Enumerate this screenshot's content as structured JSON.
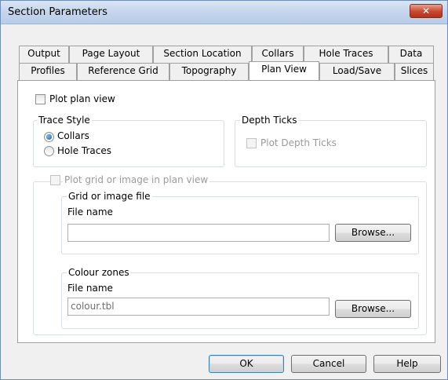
{
  "window": {
    "title": "Section Parameters",
    "close_glyph": "✕"
  },
  "tabs": {
    "row1": [
      "Output",
      "Page Layout",
      "Section Location",
      "Collars",
      "Hole Traces",
      "Data"
    ],
    "row2": [
      "Profiles",
      "Reference Grid",
      "Topography",
      "Plan View",
      "Load/Save",
      "Slices"
    ],
    "active": "Plan View"
  },
  "plan_view": {
    "plot_plan_view_label": "Plot plan view",
    "plot_plan_view_checked": false,
    "trace_style": {
      "title": "Trace Style",
      "options": [
        "Collars",
        "Hole Traces"
      ],
      "selected": "Collars"
    },
    "depth_ticks": {
      "title": "Depth Ticks",
      "plot_depth_ticks_label": "Plot Depth Ticks",
      "enabled": false
    },
    "plot_grid": {
      "label": "Plot grid or image in plan view",
      "enabled": false,
      "grid_file": {
        "title": "Grid or image file",
        "file_name_label": "File name",
        "value": "",
        "browse_label": "Browse..."
      },
      "colour_zones": {
        "title": "Colour zones",
        "file_name_label": "File name",
        "value": "colour.tbl",
        "browse_label": "Browse..."
      }
    }
  },
  "buttons": {
    "ok": "OK",
    "cancel": "Cancel",
    "help": "Help"
  }
}
